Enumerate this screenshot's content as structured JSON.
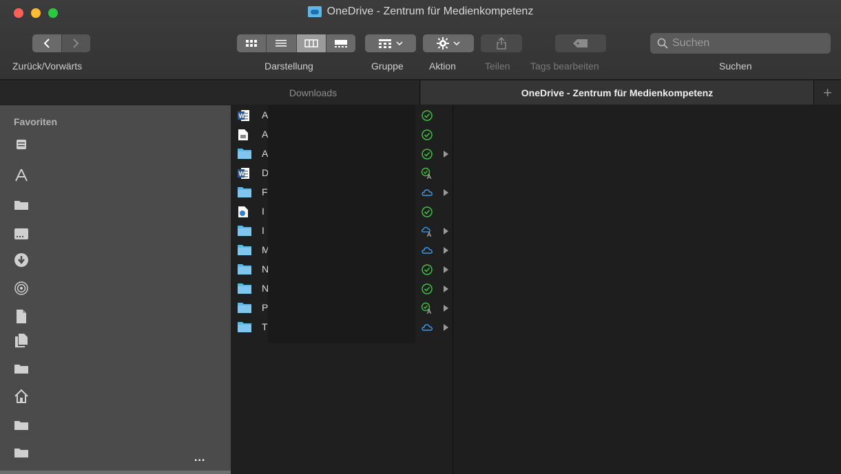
{
  "window": {
    "title": "OneDrive - Zentrum für Medienkompetenz"
  },
  "toolbar": {
    "nav_label": "Zurück/Vorwärts",
    "back_icon": "chevron-left",
    "forward_icon": "chevron-right",
    "view_label": "Darstellung",
    "group_label": "Gruppe",
    "action_label": "Aktion",
    "share_label": "Teilen",
    "tags_label": "Tags bearbeiten",
    "search_label": "Suchen",
    "search_placeholder": "Suchen",
    "view_options": [
      "icons",
      "list",
      "columns",
      "gallery"
    ],
    "active_view": "columns"
  },
  "tabs": [
    {
      "label": "Downloads",
      "active": false
    },
    {
      "label": "OneDrive - Zentrum für Medienkompetenz",
      "active": true
    }
  ],
  "tab_add_label": "+",
  "sidebar": {
    "heading": "Favoriten",
    "items": [
      {
        "icon": "recents-icon"
      },
      {
        "icon": "applications-icon"
      },
      {
        "icon": "folder-icon"
      },
      {
        "icon": "desktop-icon"
      },
      {
        "icon": "downloads-icon"
      },
      {
        "icon": "airdrop-icon"
      },
      {
        "icon": "document-icon"
      },
      {
        "icon": "documents-icon"
      },
      {
        "icon": "folder-icon"
      },
      {
        "icon": "home-icon"
      },
      {
        "icon": "folder-icon"
      },
      {
        "icon": "folder-icon"
      }
    ],
    "more_label": "..."
  },
  "files": [
    {
      "initial": "A",
      "type": "word",
      "status": "synced",
      "has_children": false
    },
    {
      "initial": "A",
      "type": "image",
      "status": "synced",
      "has_children": false
    },
    {
      "initial": "A",
      "type": "folder",
      "status": "synced",
      "has_children": true
    },
    {
      "initial": "D",
      "type": "word",
      "status": "synced-shared",
      "has_children": false
    },
    {
      "initial": "F",
      "type": "folder",
      "status": "cloud",
      "has_children": true
    },
    {
      "initial": "I",
      "type": "onedrive-file",
      "status": "synced",
      "has_children": false
    },
    {
      "initial": "I",
      "type": "folder",
      "status": "cloud-shared",
      "has_children": true
    },
    {
      "initial": "M",
      "type": "folder",
      "status": "cloud",
      "has_children": true
    },
    {
      "initial": "N",
      "type": "folder",
      "status": "synced",
      "has_children": true
    },
    {
      "initial": "N",
      "type": "folder",
      "status": "synced",
      "has_children": true
    },
    {
      "initial": "P",
      "type": "folder",
      "status": "synced-shared",
      "has_children": true
    },
    {
      "initial": "T",
      "type": "folder",
      "status": "cloud",
      "has_children": true
    }
  ],
  "colors": {
    "synced": "#3fbf3f",
    "cloud": "#3d9be9",
    "folder": "#5fb7e6",
    "close": "#fe5f57",
    "minimize": "#febc2e",
    "maximize": "#28c840"
  }
}
